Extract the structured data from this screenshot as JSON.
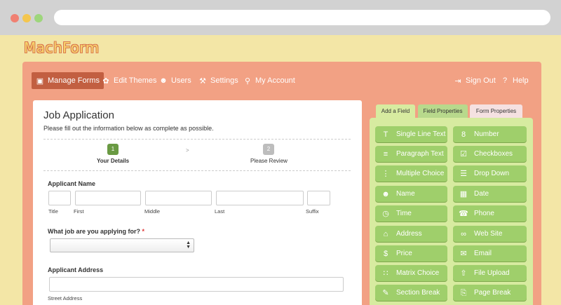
{
  "app": {
    "logo": "MachForm"
  },
  "nav": {
    "left": [
      {
        "label": "Manage Forms",
        "icon": "document-icon"
      },
      {
        "label": "Edit Themes",
        "icon": "palette-icon"
      },
      {
        "label": "Users",
        "icon": "user-icon"
      },
      {
        "label": "Settings",
        "icon": "wrench-icon"
      },
      {
        "label": "My Account",
        "icon": "key-icon"
      }
    ],
    "right": [
      {
        "label": "Sign Out",
        "icon": "signout-icon"
      },
      {
        "label": "Help",
        "icon": "help-icon"
      }
    ]
  },
  "form": {
    "title": "Job Application",
    "description": "Please fill out the information below as complete as possible.",
    "steps": [
      {
        "number": "1",
        "label": "Your Details",
        "active": true
      },
      {
        "number": "2",
        "label": "Please Review",
        "active": false
      }
    ],
    "step_separator": ">",
    "applicant_name": {
      "label": "Applicant Name",
      "sublabels": [
        "Title",
        "First",
        "Middle",
        "Last",
        "Suffix"
      ]
    },
    "job_question": {
      "label": "What job are you applying for?",
      "required_mark": "*"
    },
    "address": {
      "label": "Applicant Address",
      "sublabel": "Street Address"
    }
  },
  "tabs": [
    "Add a Field",
    "Field Properties",
    "Form Properties"
  ],
  "fields": [
    {
      "label": "Single Line Text",
      "icon": "text-t-icon"
    },
    {
      "label": "Number",
      "icon": "number-icon"
    },
    {
      "label": "Paragraph Text",
      "icon": "paragraph-icon"
    },
    {
      "label": "Checkboxes",
      "icon": "checkbox-icon"
    },
    {
      "label": "Multiple Choice",
      "icon": "list-icon"
    },
    {
      "label": "Drop Down",
      "icon": "dropdown-icon"
    },
    {
      "label": "Name",
      "icon": "person-icon"
    },
    {
      "label": "Date",
      "icon": "calendar-icon"
    },
    {
      "label": "Time",
      "icon": "clock-icon"
    },
    {
      "label": "Phone",
      "icon": "phone-icon"
    },
    {
      "label": "Address",
      "icon": "house-icon"
    },
    {
      "label": "Web Site",
      "icon": "link-icon"
    },
    {
      "label": "Price",
      "icon": "money-icon"
    },
    {
      "label": "Email",
      "icon": "envelope-icon"
    },
    {
      "label": "Matrix Choice",
      "icon": "grid-icon"
    },
    {
      "label": "File Upload",
      "icon": "upload-icon"
    },
    {
      "label": "Section Break",
      "icon": "pencil-icon"
    },
    {
      "label": "Page Break",
      "icon": "pagebreak-icon"
    }
  ],
  "colors": {
    "background": "#f3e6a6",
    "frame": "#f2a184",
    "nav_active": "#c25f41",
    "field_button": "#9fcf6b",
    "field_panel": "#d7eba0",
    "step_active": "#6a9a43",
    "step_inactive": "#bdbdbd"
  }
}
